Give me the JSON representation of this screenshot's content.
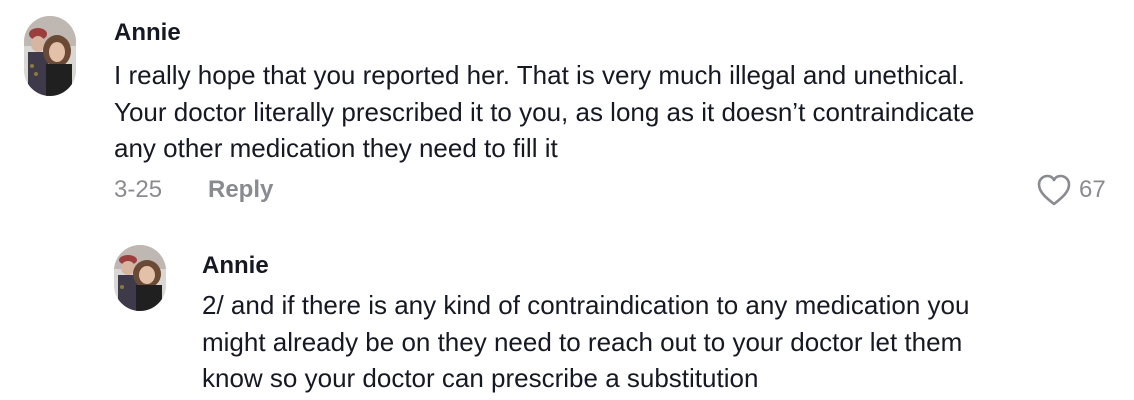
{
  "comment": {
    "username": "Annie",
    "text_lines": [
      "I really hope that you reported her. That is very much illegal and unethical.",
      "Your doctor literally prescribed it to you, as long as it doesn’t contraindicate",
      "any other medication they need to fill it"
    ],
    "date": "3-25",
    "reply_label": "Reply",
    "like_count": "67",
    "avatar_icon": "user-avatar-photo",
    "like_icon": "heart-outline-icon"
  },
  "reply": {
    "username": "Annie",
    "text_lines": [
      "2/ and if there is any kind of contraindication to any medication you",
      "might already be on they need to reach out to your doctor let them",
      "know so your doctor can prescribe a substitution"
    ],
    "avatar_icon": "user-avatar-photo"
  },
  "colors": {
    "primary_text": "#161823",
    "secondary_text": "#8a8b91",
    "background": "#ffffff"
  }
}
